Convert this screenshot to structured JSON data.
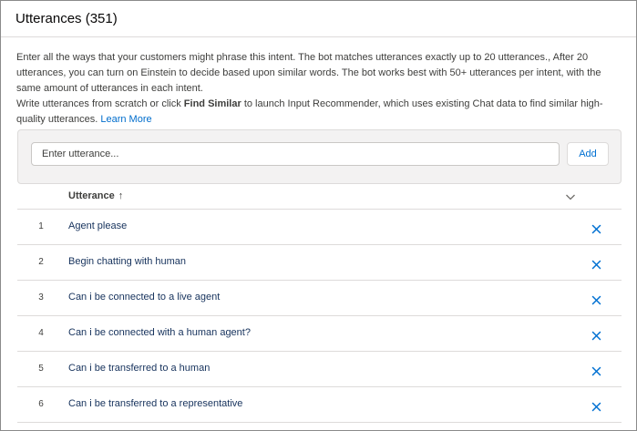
{
  "header": {
    "title": "Utterances (351)"
  },
  "description": {
    "line1": "Enter all the ways that your customers might phrase this intent. The bot matches utterances exactly up to 20 utterances., After 20 utterances, you can turn on Einstein to decide based upon similar words. The bot works best with 50+ utterances per intent, with the same amount of utterances in each intent.",
    "line2_prefix": "Write utterances from scratch or click ",
    "line2_bold": "Find Similar",
    "line2_suffix": " to launch Input Recommender, which uses existing Chat data to find similar high-quality utterances. ",
    "learn_more": "Learn More"
  },
  "input": {
    "placeholder": "Enter utterance...",
    "value": "",
    "add_label": "Add"
  },
  "table": {
    "column_header": "Utterance",
    "sort_icon": "arrow-up-icon",
    "menu_icon": "chevron-down-icon",
    "delete_icon": "close-icon",
    "rows": [
      {
        "num": "1",
        "text": "Agent please"
      },
      {
        "num": "2",
        "text": "Begin chatting with human"
      },
      {
        "num": "3",
        "text": "Can i be connected to a live agent"
      },
      {
        "num": "4",
        "text": "Can i be connected with a human agent?"
      },
      {
        "num": "5",
        "text": "Can i be transferred to a human"
      },
      {
        "num": "6",
        "text": "Can i be transferred to a representative"
      }
    ]
  },
  "colors": {
    "link": "#006dcc",
    "icon_blue": "#0070d2",
    "border": "#dddbda",
    "panel_bg": "#f3f2f2"
  }
}
